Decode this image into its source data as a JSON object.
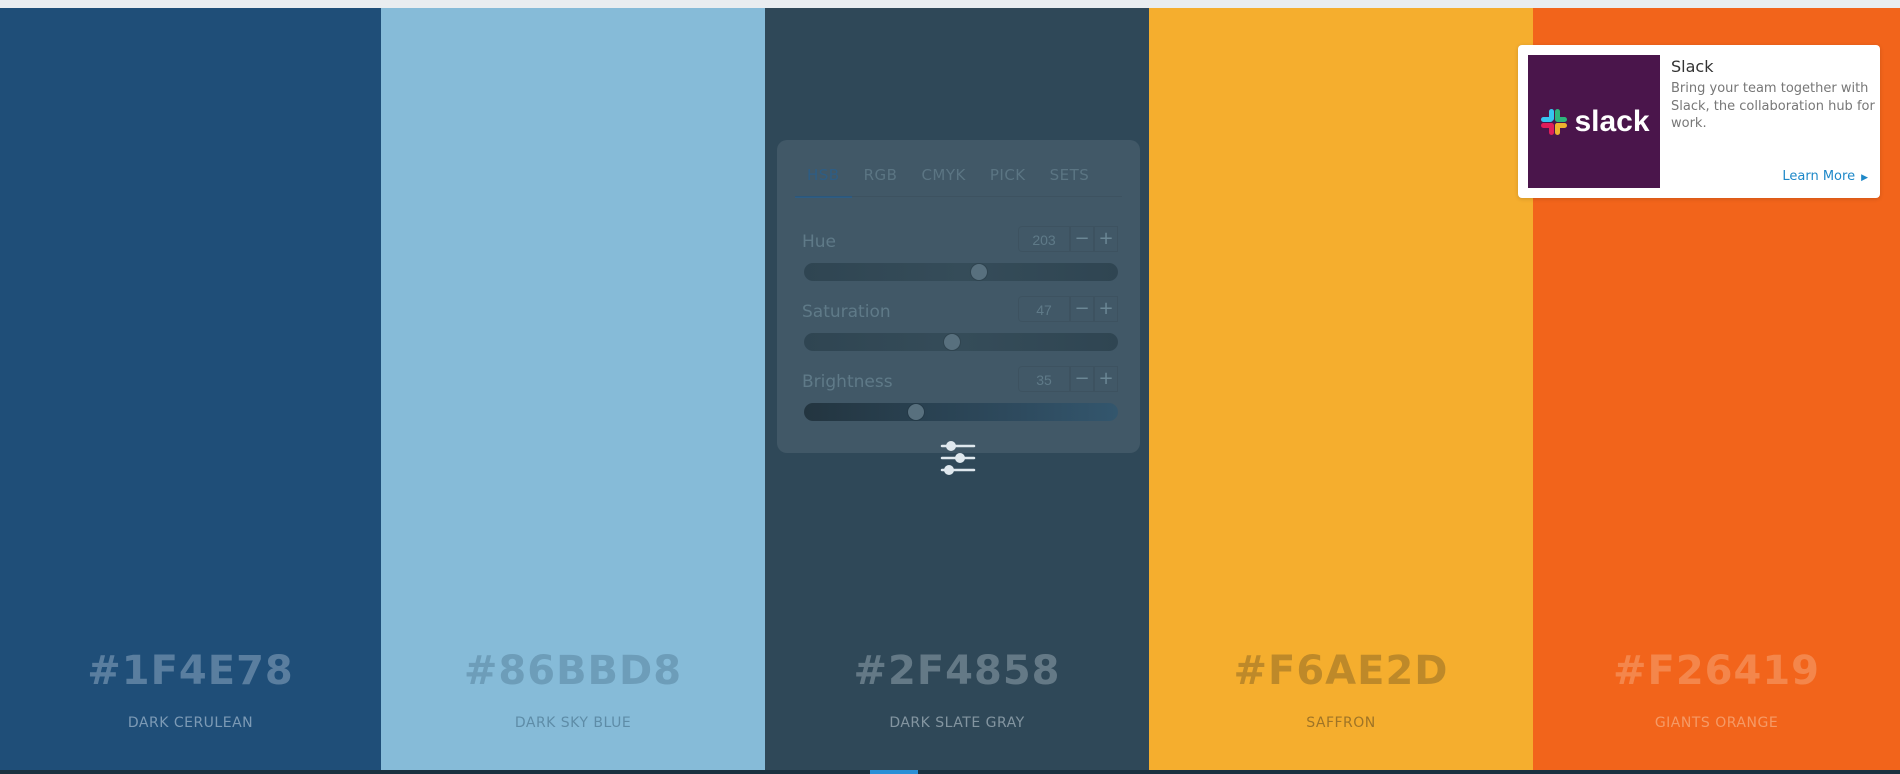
{
  "palette": {
    "colors": [
      {
        "hex": "#1F4E78",
        "name": "DARK CERULEAN",
        "background": "#1f4e78",
        "text_color": "#c8d8e8"
      },
      {
        "hex": "#86BBD8",
        "name": "DARK SKY BLUE",
        "background": "#86bbd8",
        "text_color": "#3f6780"
      },
      {
        "hex": "#2F4858",
        "name": "DARK SLATE GRAY",
        "background": "#2f4858",
        "text_color": "#c8d4dc"
      },
      {
        "hex": "#F6AE2D",
        "name": "SAFFRON",
        "background": "#f5ae2e",
        "text_color": "#5a4520"
      },
      {
        "hex": "#F26419",
        "name": "GIANTS ORANGE",
        "background": "#f2641b",
        "text_color": "#f8c7a4"
      }
    ]
  },
  "adjust_panel": {
    "tabs": [
      {
        "label": "HSB",
        "active": true
      },
      {
        "label": "RGB",
        "active": false
      },
      {
        "label": "CMYK",
        "active": false
      },
      {
        "label": "PICK",
        "active": false
      },
      {
        "label": "SETS",
        "active": false
      }
    ],
    "controls": [
      {
        "label": "Hue",
        "value": "203",
        "level": 0.56,
        "minus": "−",
        "plus": "+"
      },
      {
        "label": "Saturation",
        "value": "47",
        "level": 0.47,
        "minus": "−",
        "plus": "+"
      },
      {
        "label": "Brightness",
        "value": "35",
        "level": 0.35,
        "minus": "−",
        "plus": "+"
      }
    ],
    "toggle_icon": "sliders-icon"
  },
  "ad": {
    "logo_text": "slack",
    "logo_background": "#4a154b",
    "title": "Slack",
    "text": "Bring your team together with Slack, the collaboration hub for work.",
    "cta": "Learn More",
    "cta_color": "#1e88c8"
  }
}
